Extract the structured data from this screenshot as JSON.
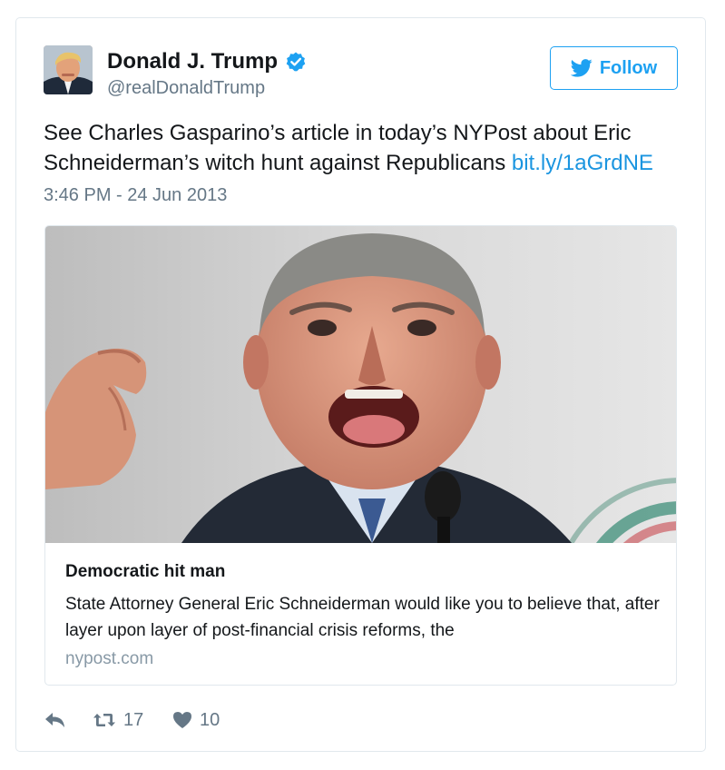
{
  "author": {
    "display_name": "Donald J. Trump",
    "handle": "@realDonaldTrump",
    "verified": true
  },
  "follow_button": {
    "label": "Follow",
    "icon": "twitter-bird-icon"
  },
  "tweet": {
    "text": "See Charles Gasparino’s article in today’s NYPost about Eric Schneiderman’s witch hunt against Republicans",
    "link_text": "bit.ly/1aGrdNE",
    "timestamp": "3:46 PM - 24 Jun 2013"
  },
  "link_card": {
    "title": "Democratic hit man",
    "description": "State Attorney General Eric Schneiderman would like you to believe that, after layer upon layer of post-financial crisis reforms, the",
    "domain": "nypost.com"
  },
  "actions": {
    "reply_icon": "reply-icon",
    "retweet_icon": "retweet-icon",
    "retweet_count": "17",
    "like_icon": "heart-icon",
    "like_count": "10"
  },
  "colors": {
    "accent": "#1da1f2",
    "link": "#1b95e0",
    "secondary_text": "#657786",
    "border": "#e1e8ed"
  }
}
